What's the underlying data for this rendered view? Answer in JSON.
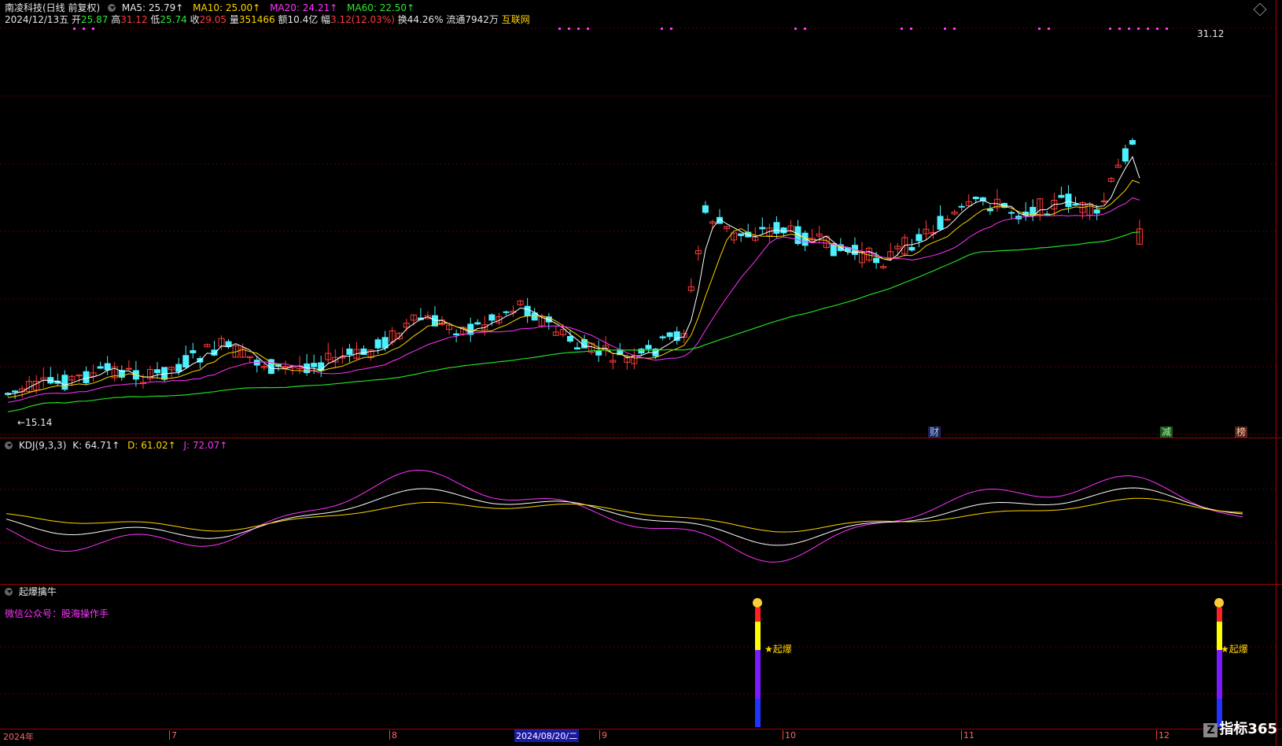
{
  "header": {
    "title": "南凌科技(日线 前复权)",
    "ma5": "MA5: 25.79↑",
    "ma10": "MA10: 25.00↑",
    "ma20": "MA20: 24.21↑",
    "ma60": "MA60: 22.50↑"
  },
  "info": {
    "date": "2024/12/13五",
    "open_lbl": "开",
    "open": "25.87",
    "high_lbl": "高",
    "high": "31.12",
    "low_lbl": "低",
    "low": "25.74",
    "close_lbl": "收",
    "close": "29.05",
    "vol_lbl": "量",
    "vol": "351466",
    "amt_lbl": "额",
    "amt": "10.4亿",
    "chg_lbl": "幅",
    "chg": "3.12(12.03%)",
    "turn": "换44.26%",
    "float": "流通7942万",
    "sector": "互联网"
  },
  "price_labels": {
    "max": "31.12",
    "min": "15.14"
  },
  "event_marks": {
    "cai": "财",
    "jian": "减",
    "bang": "榜"
  },
  "kdj": {
    "title": "KDJ(9,3,3)",
    "k": "K: 64.71↑",
    "d": "D: 61.02↑",
    "j": "J: 72.07↑"
  },
  "indicator": {
    "title": "起爆擒牛",
    "wechat": "微信公众号：股海操作手",
    "signal_label": "★起爆"
  },
  "xaxis": {
    "labels": [
      "2024年",
      "7",
      "8",
      "9",
      "10",
      "11",
      "12"
    ],
    "highlight": "2024/08/20/二"
  },
  "brand": "指标365",
  "colors": {
    "up": "#ff3b3b",
    "down": "#4df0ff",
    "ma5": "#ffffff",
    "ma10": "#ffd400",
    "ma20": "#ff33ff",
    "ma60": "#22dd22",
    "border": "#a00000"
  }
}
